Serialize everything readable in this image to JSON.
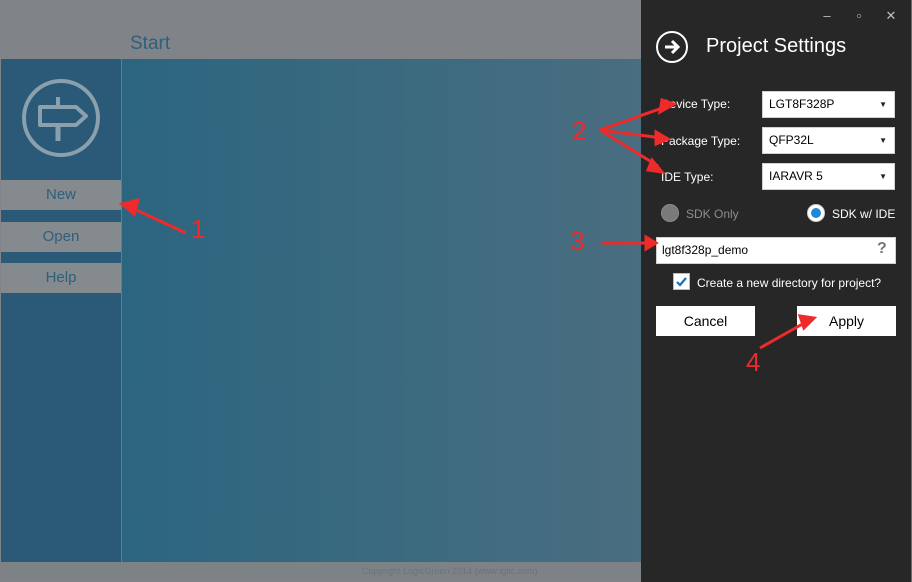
{
  "start_view": {
    "title": "Start",
    "menu": [
      "New",
      "Open",
      "Help"
    ],
    "copyright": "Copyright LogicGreen 2014 (www.lgtic.com)"
  },
  "window_controls": {
    "minimize": "‒",
    "maximize": "▫",
    "close": "✕"
  },
  "panel": {
    "title": "Project Settings",
    "device_type": {
      "label": "Device Type:",
      "value": "LGT8F328P"
    },
    "package_type": {
      "label": "Package Type:",
      "value": "QFP32L"
    },
    "ide_type": {
      "label": "IDE Type:",
      "value": "IARAVR 5"
    },
    "radio_sdk_only": {
      "label": "SDK Only",
      "selected": false
    },
    "radio_sdk_ide": {
      "label": "SDK w/ IDE",
      "selected": true
    },
    "project_name": "lgt8f328p_demo",
    "help_glyph": "?",
    "create_dir": {
      "label": "Create a new directory for project?",
      "checked": true
    },
    "cancel_label": "Cancel",
    "apply_label": "Apply"
  },
  "annotations": [
    "1",
    "2",
    "3",
    "4"
  ],
  "colors": {
    "accent_blue": "#2a5a77",
    "panel_bg": "#272727",
    "annotation_red": "#ee2a2a",
    "radio_selected": "#1e8ad6"
  }
}
